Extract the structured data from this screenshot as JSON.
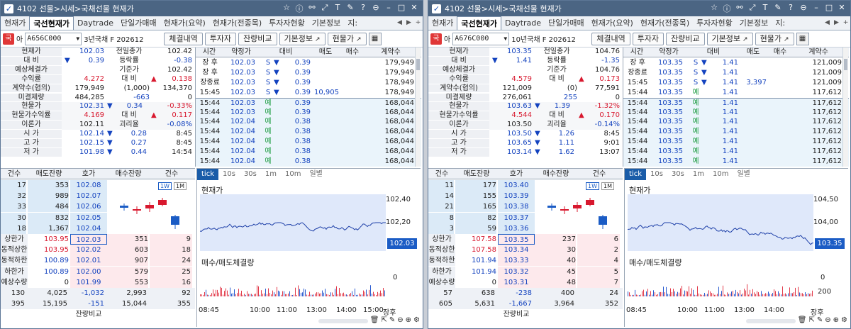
{
  "app": {
    "tab_labels": [
      "현재가",
      "국선현재가",
      "Daytrade",
      "단일가매매",
      "현재가(요약)",
      "현재가(전종목)",
      "투자자현황",
      "기본정보",
      "지:"
    ],
    "buttons": {
      "trades": "체결내역",
      "investor": "투자자",
      "balance": "잔량비교",
      "info": "기본정보",
      "spot": "현물가"
    },
    "small_arrow": "아"
  },
  "info_labels": [
    "현재가",
    "대 비",
    "예상체결가",
    "수익률",
    "계약수(협의)",
    "미결제량",
    "현물가",
    "현물가수익률",
    "이론가",
    "시 가",
    "고 가",
    "저 가"
  ],
  "info_right_labels": [
    "전일종가",
    "등락률",
    "기준가",
    "대 비"
  ],
  "trade_headers": [
    "시간",
    "약정가",
    "대비",
    "매도",
    "매수",
    "계약수"
  ],
  "book_headers": [
    "건수",
    "매도잔량",
    "호가",
    "매수잔량",
    "건수"
  ],
  "book_labels": {
    "upper": "상한가",
    "dyn_upper": "동적상한",
    "dyn_lower": "동적하한",
    "lower": "하한가",
    "exp_qty": "예상수량"
  },
  "chart_labels": {
    "tick": "tick",
    "intervals": [
      "10s",
      "30s",
      "1m",
      "10m",
      "일별"
    ],
    "price_title": "현재가",
    "volume_title": "매수/매도체결량",
    "btn_1w": "1W",
    "btn_1m": "1M",
    "close_label": "장후",
    "balance_compare": "잔량비교"
  },
  "panels": [
    {
      "title": "4102 선물>시세>국채선물 현재가",
      "code": "A656C000",
      "contract": "3년국채 F 202612",
      "info": {
        "cur": "102.03",
        "cur_arrow": "▼",
        "diff": "0.39",
        "exp": "",
        "yield": "4.272",
        "qty": "179,949",
        "qty_sub": "(1,000)",
        "oi": "484,285",
        "oi_chg": "-663",
        "spot": "102.31",
        "spot_arrow": "▼",
        "spot_diff": "0.34",
        "spot_pct": "-0.33%",
        "spot_yield": "4.169",
        "theo": "102.11",
        "open": "102.14",
        "open_arrow": "▼",
        "open_diff": "0.28",
        "open_t": "8:45",
        "high": "102.15",
        "high_arrow": "▼",
        "high_diff": "0.27",
        "high_t": "8:45",
        "low": "101.98",
        "low_arrow": "▼",
        "low_diff": "0.44",
        "low_t": "14:54",
        "prev_close": "102.42",
        "pct": "-0.38",
        "base": "102.42",
        "r_diff": "0.138",
        "r_diff_arrow": "▲",
        "oi_prev": "134,370",
        "oi_zero": "0",
        "spot_r": "0.117",
        "spot_r_arrow": "▲",
        "gap_label": "괴리율",
        "gap": "-0.08%"
      },
      "trades": [
        {
          "t": "장 후",
          "p": "102.03",
          "s": "S",
          "a": "▼",
          "d": "0.39",
          "sell": "",
          "buy": "",
          "q": "179,949"
        },
        {
          "t": "장 후",
          "p": "102.03",
          "s": "S",
          "a": "▼",
          "d": "0.39",
          "sell": "",
          "buy": "",
          "q": "179,949"
        },
        {
          "t": "장종료",
          "p": "102.03",
          "s": "S",
          "a": "▼",
          "d": "0.39",
          "sell": "",
          "buy": "",
          "q": "178,949"
        },
        {
          "t": "15:45",
          "p": "102.03",
          "s": "S",
          "a": "▼",
          "d": "0.39",
          "sell": "10,905",
          "buy": "",
          "q": "178,949"
        },
        {
          "t": "15:44",
          "p": "102.03",
          "s": "예",
          "a": "",
          "d": "0.39",
          "sell": "",
          "buy": "",
          "q": "168,044"
        },
        {
          "t": "15:44",
          "p": "102.03",
          "s": "예",
          "a": "",
          "d": "0.39",
          "sell": "",
          "buy": "",
          "q": "168,044"
        },
        {
          "t": "15:44",
          "p": "102.04",
          "s": "예",
          "a": "",
          "d": "0.38",
          "sell": "",
          "buy": "",
          "q": "168,044"
        },
        {
          "t": "15:44",
          "p": "102.04",
          "s": "예",
          "a": "",
          "d": "0.38",
          "sell": "",
          "buy": "",
          "q": "168,044"
        },
        {
          "t": "15:44",
          "p": "102.04",
          "s": "예",
          "a": "",
          "d": "0.38",
          "sell": "",
          "buy": "",
          "q": "168,044"
        },
        {
          "t": "15:44",
          "p": "102.04",
          "s": "예",
          "a": "",
          "d": "0.38",
          "sell": "",
          "buy": "",
          "q": "168,044"
        },
        {
          "t": "15:44",
          "p": "102.04",
          "s": "예",
          "a": "",
          "d": "0.38",
          "sell": "",
          "buy": "",
          "q": "168,044"
        }
      ],
      "asks": [
        [
          "17",
          "353",
          "102.08"
        ],
        [
          "32",
          "989",
          "102.07"
        ],
        [
          "33",
          "484",
          "102.06"
        ],
        [
          "30",
          "832",
          "102.05"
        ],
        [
          "18",
          "1,367",
          "102.04"
        ]
      ],
      "bids": [
        [
          "102.03",
          "351",
          "9"
        ],
        [
          "102.02",
          "603",
          "18"
        ],
        [
          "102.01",
          "907",
          "24"
        ],
        [
          "102.00",
          "579",
          "25"
        ],
        [
          "101.99",
          "553",
          "16"
        ]
      ],
      "upper": "103.95",
      "dyn_upper": "103.95",
      "dyn_lower": "100.89",
      "lower": "100.89",
      "exp_qty": "0",
      "tot1": [
        "130",
        "4,025",
        "-1,032",
        "2,993",
        "92"
      ],
      "tot2": [
        "395",
        "15,195",
        "-151",
        "15,044",
        "355"
      ],
      "chart": {
        "y_top": "102,40",
        "y_mid": "102,20",
        "cur": "102.03",
        "vol": "0",
        "times": [
          "08:45",
          "10:00",
          "11:00",
          "13:00",
          "14:00",
          "15:00"
        ]
      }
    },
    {
      "title": "4102 선물>시세>국채선물 현재가",
      "code": "A676C000",
      "contract": "10년국채 F 202612",
      "info": {
        "cur": "103.35",
        "cur_arrow": "▼",
        "diff": "1.41",
        "exp": "",
        "yield": "4.579",
        "qty": "121,009",
        "qty_sub": "(0)",
        "oi": "276,061",
        "oi_chg": "255",
        "spot": "103.63",
        "spot_arrow": "▼",
        "spot_diff": "1.39",
        "spot_pct": "-1.32%",
        "spot_yield": "4.544",
        "theo": "103.50",
        "open": "103.50",
        "open_arrow": "▼",
        "open_diff": "1.26",
        "open_t": "8:45",
        "high": "103.65",
        "high_arrow": "▼",
        "high_diff": "1.11",
        "high_t": "9:01",
        "low": "103.14",
        "low_arrow": "▼",
        "low_diff": "1.62",
        "low_t": "13:07",
        "prev_close": "104.76",
        "pct": "-1.35",
        "base": "104.76",
        "r_diff": "0.173",
        "r_diff_arrow": "▲",
        "oi_prev": "77,591",
        "oi_zero": "0",
        "spot_r": "0.170",
        "spot_r_arrow": "▲",
        "gap_label": "괴리율",
        "gap": "-0.14%"
      },
      "trades": [
        {
          "t": "장 후",
          "p": "103.35",
          "s": "S",
          "a": "▼",
          "d": "1.41",
          "sell": "",
          "buy": "",
          "q": "121,009"
        },
        {
          "t": "장종료",
          "p": "103.35",
          "s": "S",
          "a": "▼",
          "d": "1.41",
          "sell": "",
          "buy": "",
          "q": "121,009"
        },
        {
          "t": "15:45",
          "p": "103.35",
          "s": "S",
          "a": "▼",
          "d": "1.41",
          "sell": "3,397",
          "buy": "",
          "q": "121,009"
        },
        {
          "t": "15:44",
          "p": "103.35",
          "s": "예",
          "a": "",
          "d": "1.41",
          "sell": "",
          "buy": "",
          "q": "117,612"
        },
        {
          "t": "15:44",
          "p": "103.35",
          "s": "예",
          "a": "",
          "d": "1.41",
          "sell": "",
          "buy": "",
          "q": "117,612"
        },
        {
          "t": "15:44",
          "p": "103.35",
          "s": "예",
          "a": "",
          "d": "1.41",
          "sell": "",
          "buy": "",
          "q": "117,612"
        },
        {
          "t": "15:44",
          "p": "103.35",
          "s": "예",
          "a": "",
          "d": "1.41",
          "sell": "",
          "buy": "",
          "q": "117,612"
        },
        {
          "t": "15:44",
          "p": "103.35",
          "s": "예",
          "a": "",
          "d": "1.41",
          "sell": "",
          "buy": "",
          "q": "117,612"
        },
        {
          "t": "15:44",
          "p": "103.35",
          "s": "예",
          "a": "",
          "d": "1.41",
          "sell": "",
          "buy": "",
          "q": "117,612"
        },
        {
          "t": "15:44",
          "p": "103.35",
          "s": "예",
          "a": "",
          "d": "1.41",
          "sell": "",
          "buy": "",
          "q": "117,612"
        },
        {
          "t": "15:44",
          "p": "103.35",
          "s": "예",
          "a": "",
          "d": "1.41",
          "sell": "",
          "buy": "",
          "q": "117,612"
        }
      ],
      "asks": [
        [
          "11",
          "177",
          "103.40"
        ],
        [
          "14",
          "155",
          "103.39"
        ],
        [
          "21",
          "165",
          "103.38"
        ],
        [
          "8",
          "82",
          "103.37"
        ],
        [
          "3",
          "59",
          "103.36"
        ]
      ],
      "bids": [
        [
          "103.35",
          "237",
          "6"
        ],
        [
          "103.34",
          "30",
          "2"
        ],
        [
          "103.33",
          "40",
          "4"
        ],
        [
          "103.32",
          "45",
          "5"
        ],
        [
          "103.31",
          "48",
          "7"
        ]
      ],
      "upper": "107.58",
      "dyn_upper": "107.58",
      "dyn_lower": "101.94",
      "lower": "101.94",
      "exp_qty": "0",
      "tot1": [
        "57",
        "638",
        "-238",
        "400",
        "24"
      ],
      "tot2": [
        "605",
        "5,631",
        "-1,667",
        "3,964",
        "352"
      ],
      "chart": {
        "y_top": "104,50",
        "y_mid": "104,00",
        "y_vol": "200",
        "cur": "103.35",
        "vol": "0",
        "times": [
          "08:45",
          "10:00",
          "11:00",
          "13:00",
          "14:00"
        ]
      }
    }
  ]
}
